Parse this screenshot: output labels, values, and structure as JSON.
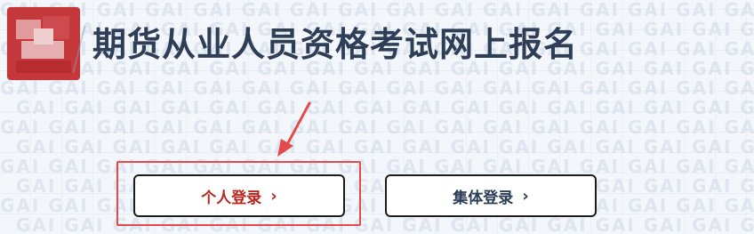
{
  "header": {
    "title": "期货从业人员资格考试网上报名",
    "logo_icon": "association-logo-icon"
  },
  "login": {
    "personal_label": "个人登录",
    "group_label": "集体登录",
    "chevron": "›"
  },
  "colors": {
    "title": "#2f3e57",
    "personal_text": "#b7261f",
    "group_text": "#2c3d57",
    "highlight_border": "#e34b4b",
    "arrow": "#e34b4b",
    "background": "#f3f6fb"
  }
}
